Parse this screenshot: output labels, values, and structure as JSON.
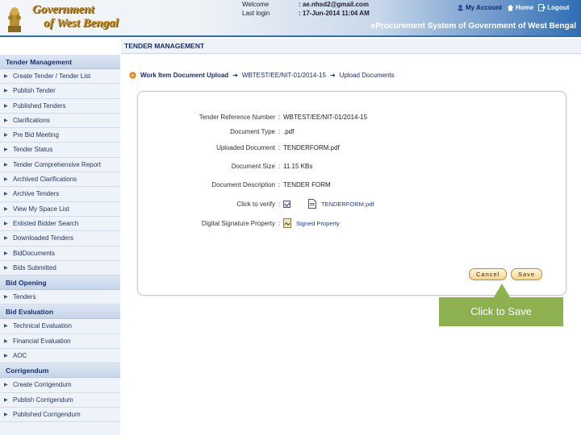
{
  "header": {
    "logo_line1": "Government",
    "logo_line2": "of West Bengal",
    "welcome_label": "Welcome",
    "welcome_value": ": ae.nhsd2@gmail.com",
    "last_login_label": "Last login",
    "last_login_value": ": 17-Jun-2014 11:04 AM",
    "my_account": "My Account",
    "home": "Home",
    "logout": "Logout",
    "system_title": "eProcurement System of Government of West Bengal"
  },
  "page_title": "TENDER MANAGEMENT",
  "sidebar": {
    "sections": [
      {
        "title": "Tender Management",
        "items": [
          "Create Tender / Tender List",
          "Publish Tender",
          "Published Tenders",
          "Clarifications",
          "Pre Bid Meeting",
          "Tender Status",
          "Tender Comprehensive Report",
          "Archived Clarifications",
          "Archive Tenders",
          "View My Space List",
          "Enlisted Bidder Search",
          "Downloaded Tenders",
          "BidDocuments",
          "Bids Submitted"
        ]
      },
      {
        "title": "Bid Opening",
        "items": [
          "Tenders"
        ]
      },
      {
        "title": "Bid Evaluation",
        "items": [
          "Technical Evaluation",
          "Financial Evaluation",
          "AOC"
        ]
      },
      {
        "title": "Corrigendum",
        "items": [
          "Create Corrigendum",
          "Publish Corrigendum",
          "Published Corrigendum"
        ]
      }
    ]
  },
  "breadcrumb": {
    "first": "Work Item Document Upload",
    "second": "WBTEST/EE/NIT-01/2014-15",
    "third": "Upload Documents"
  },
  "form": {
    "tender_ref_label": "Tender Reference Number",
    "tender_ref_value": "WBTEST/EE/NIT-01/2014-15",
    "doc_type_label": "Document Type",
    "doc_type_value": ".pdf",
    "uploaded_label": "Uploaded Document",
    "uploaded_value": "TENDERFORM.pdf",
    "size_label": "Document Size",
    "size_value": "11.15 KBs",
    "desc_label": "Document Description",
    "desc_value": "TENDER FORM",
    "verify_label": "Click to verify",
    "verify_file": "TENDERFORM.pdf",
    "sig_label": "Digital Signature Property",
    "sig_link": "Signed Property"
  },
  "buttons": {
    "cancel": "Cancel",
    "save": "Save"
  },
  "callout": "Click to Save",
  "colors": {
    "header_blue": "#2e6db5",
    "callout_green": "#8db14f",
    "nav_text": "#1b2f6b"
  }
}
